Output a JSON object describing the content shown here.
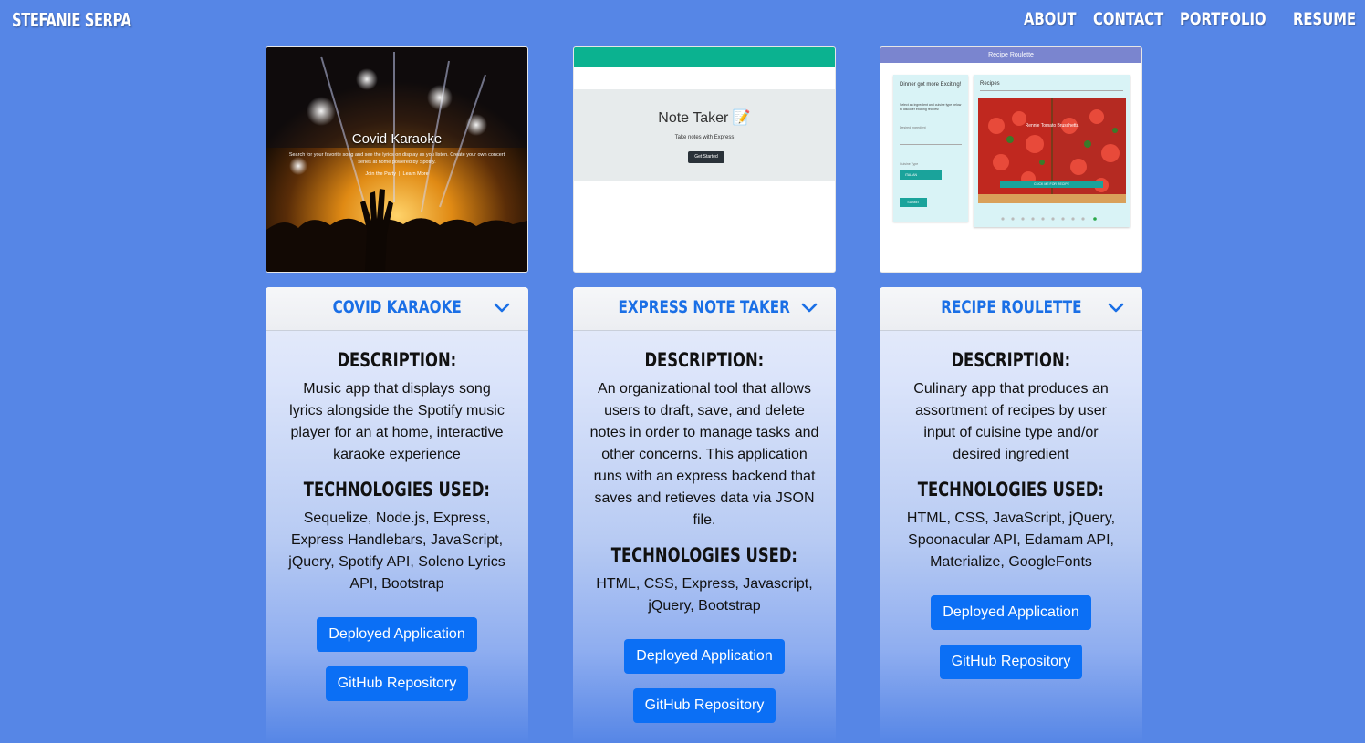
{
  "nav": {
    "brand": "STEFANIE SERPA",
    "links": [
      "ABOUT",
      "CONTACT",
      "PORTFOLIO",
      "RESUME"
    ]
  },
  "projects": [
    {
      "screenshot": {
        "title": "Covid Karaoke",
        "subtitle": "Search for your favorite song and see the lyrics on display as you listen. Create your own concert series at home powered by Spotify.",
        "link1": "Join the Party",
        "link2": "Learn More"
      },
      "title": "COVID KARAOKE",
      "description_heading": "DESCRIPTION:",
      "description": "Music app that displays song lyrics alongside the Spotify music player for an at home, interactive karaoke experience",
      "tech_heading": "TECHNOLOGIES USED:",
      "technologies": "Sequelize, Node.js, Express, Express Handlebars, JavaScript, jQuery, Spotify API, Soleno Lyrics API, Bootstrap",
      "deployed_label": "Deployed Application",
      "github_label": "GitHub Repository"
    },
    {
      "screenshot": {
        "title": "Note Taker 📝",
        "subtitle": "Take notes with Express",
        "button": "Get Started"
      },
      "title": "EXPRESS NOTE TAKER",
      "description_heading": "DESCRIPTION:",
      "description": "An organizational tool that allows users to draft, save, and delete notes in order to manage tasks and other concerns. This application runs with an express backend that saves and retieves data via JSON file.",
      "tech_heading": "TECHNOLOGIES USED:",
      "technologies": "HTML, CSS, Express, Javascript, jQuery, Bootstrap",
      "deployed_label": "Deployed Application",
      "github_label": "GitHub Repository"
    },
    {
      "screenshot": {
        "header": "Recipe Roulette",
        "left_title": "Dinner got more Exciting!",
        "left_text": "Select an ingredient and cuisine type below to discover exciting recipes!",
        "left_field": "Desired Ingredient",
        "left_select_label": "Cuisine Type",
        "left_select": "ITALIAN",
        "left_submit": "SUBMIT",
        "right_title": "Recipes",
        "recipe_name": "Rennie Tomato Bruschetta",
        "recipe_button": "CLICK ME FOR RECIPE"
      },
      "title": "RECIPE ROULETTE",
      "description_heading": "DESCRIPTION:",
      "description": "Culinary app that produces an assortment of recipes by user input of cuisine type and/or desired ingredient",
      "tech_heading": "TECHNOLOGIES USED:",
      "technologies": "HTML, CSS, JavaScript, jQuery, Spoonacular API, Edamam API, Materialize, GoogleFonts",
      "deployed_label": "Deployed Application",
      "github_label": "GitHub Repository"
    }
  ]
}
